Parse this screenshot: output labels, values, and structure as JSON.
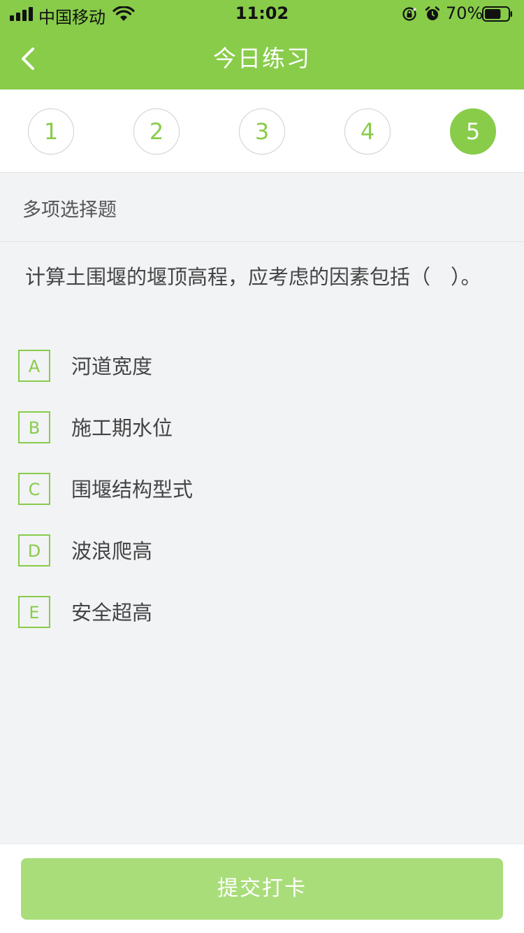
{
  "status_bar": {
    "carrier": "中国移动",
    "time": "11:02",
    "battery_percent": "70%",
    "battery_level": 0.7,
    "icons": [
      "signal-icon",
      "wifi-icon",
      "orientation-lock-icon",
      "alarm-icon",
      "battery-icon"
    ]
  },
  "nav": {
    "title": "今日练习",
    "back_icon": "chevron-left-icon"
  },
  "steps": {
    "items": [
      "1",
      "2",
      "3",
      "4",
      "5"
    ],
    "active": "5"
  },
  "question": {
    "type": "多项选择题",
    "text": "计算土围堰的堰顶高程，应考虑的因素包括（　）。",
    "options": [
      {
        "letter": "A",
        "text": "河道宽度"
      },
      {
        "letter": "B",
        "text": "施工期水位"
      },
      {
        "letter": "C",
        "text": "围堰结构型式"
      },
      {
        "letter": "D",
        "text": "波浪爬高"
      },
      {
        "letter": "E",
        "text": "安全超高"
      }
    ]
  },
  "footer": {
    "submit_label": "提交打卡"
  },
  "colors": {
    "accent": "#88cc4a",
    "accent_light": "#a9dd7a",
    "background": "#f2f3f5"
  }
}
